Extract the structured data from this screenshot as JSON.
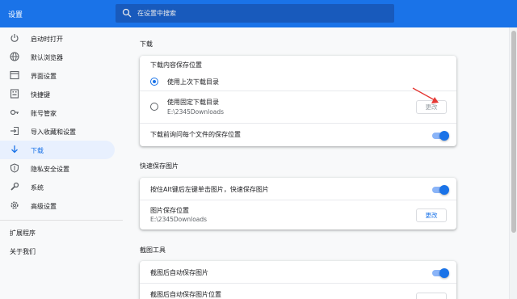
{
  "header": {
    "title": "设置",
    "search_placeholder": "在设置中搜索"
  },
  "sidebar": {
    "items": [
      {
        "label": "启动时打开",
        "icon": "power-icon"
      },
      {
        "label": "默认浏览器",
        "icon": "globe-icon"
      },
      {
        "label": "界面设置",
        "icon": "window-icon"
      },
      {
        "label": "快捷键",
        "icon": "keyboard-icon"
      },
      {
        "label": "账号管家",
        "icon": "key-icon"
      },
      {
        "label": "导入收藏和设置",
        "icon": "import-icon"
      },
      {
        "label": "下载",
        "icon": "download-icon",
        "active": true
      },
      {
        "label": "隐私安全设置",
        "icon": "shield-icon"
      },
      {
        "label": "系统",
        "icon": "wrench-icon"
      },
      {
        "label": "高级设置",
        "icon": "gear-icon"
      }
    ],
    "links": {
      "extensions": "扩展程序",
      "about": "关于我们"
    }
  },
  "download": {
    "section_title": "下载",
    "location_title": "下载内容保存位置",
    "option_last": "使用上次下载目录",
    "option_fixed": "使用固定下载目录",
    "fixed_path": "E:\\2345Downloads",
    "change_label": "更改",
    "ask_each": "下载前询问每个文件的保存位置",
    "ask_each_on": true
  },
  "quick_save": {
    "section_title": "快速保存图片",
    "alt_click": "按住Alt键后左键单击图片，快速保存图片",
    "alt_click_on": true,
    "image_location": "图片保存位置",
    "image_path": "E:\\2345Downloads",
    "change_label": "更改"
  },
  "screenshot": {
    "section_title": "截图工具",
    "auto_save": "截图后自动保存图片",
    "auto_save_on": true,
    "auto_save_location": "截图后自动保存图片位置"
  },
  "colors": {
    "accent": "#1a73e8",
    "header": "#1a73e8",
    "arrow": "#e53935"
  }
}
